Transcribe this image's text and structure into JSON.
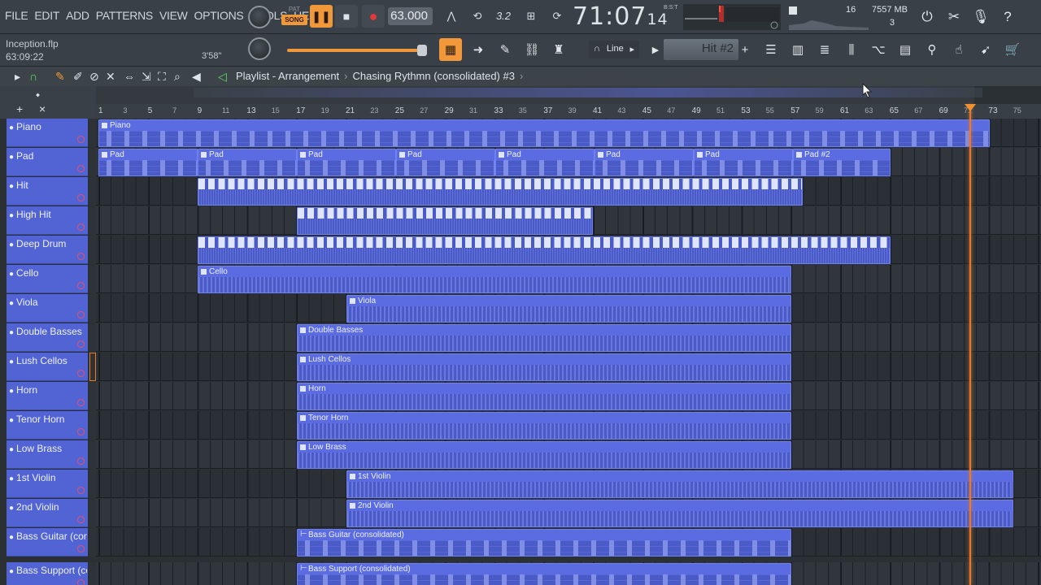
{
  "menu": [
    "FILE",
    "EDIT",
    "ADD",
    "PATTERNS",
    "VIEW",
    "OPTIONS",
    "TOOLS",
    "HELP"
  ],
  "transport": {
    "pat_label": "PAT",
    "song_label": "SONG",
    "play_icon": "pause-icon",
    "stop_icon": "stop-icon",
    "record_icon": "record-icon",
    "tempo": "63.000",
    "time_main": "71:07",
    "time_sub": "14",
    "time_format": "B:S:T"
  },
  "cpu_panel": {
    "voices": "16",
    "memory": "7557 MB",
    "polyphony": "3"
  },
  "project": {
    "name": "Inception.flp",
    "time": "63:09:22",
    "length": "3'58\""
  },
  "snap": {
    "label": "Line"
  },
  "selected_pattern": {
    "label": "Hit #2",
    "add_label": "+"
  },
  "playlist": {
    "title": "Playlist - Arrangement",
    "pattern": "Chasing Rythmn (consolidated) #3"
  },
  "ruler": {
    "major": [
      "1",
      "5",
      "9",
      "13",
      "17",
      "21",
      "25",
      "29",
      "33",
      "37",
      "41",
      "45",
      "49",
      "53",
      "57",
      "61",
      "65",
      "69",
      "73"
    ],
    "minor": [
      "3",
      "7",
      "11",
      "15",
      "19",
      "23",
      "27",
      "31",
      "35",
      "39",
      "43",
      "47",
      "51",
      "55",
      "59",
      "63",
      "67",
      "71",
      "75"
    ]
  },
  "tracks": [
    {
      "name": "Piano"
    },
    {
      "name": "Pad"
    },
    {
      "name": "Hit"
    },
    {
      "name": "High Hit"
    },
    {
      "name": "Deep Drum"
    },
    {
      "name": "Cello"
    },
    {
      "name": "Viola"
    },
    {
      "name": "Double Basses"
    },
    {
      "name": "Lush Cellos"
    },
    {
      "name": "Horn"
    },
    {
      "name": "Tenor Horn"
    },
    {
      "name": "Low Brass"
    },
    {
      "name": "1st Violin"
    },
    {
      "name": "2nd Violin"
    },
    {
      "name": "Bass Guitar (conso..."
    },
    {
      "name": "Bass Support (con..."
    }
  ],
  "clips": {
    "piano": "Piano",
    "pad": "Pad",
    "pad2": "Pad #2",
    "cello": "Cello",
    "viola": "Viola",
    "double_basses": "Double Basses",
    "lush_cellos": "Lush Cellos",
    "horn": "Horn",
    "tenor_horn": "Tenor Horn",
    "low_brass": "Low Brass",
    "violin1": "1st Violin",
    "violin2": "2nd Violin",
    "bass_guitar": "Bass Guitar (consolidated)",
    "bass_support": "Bass Support (consolidated)"
  },
  "colors": {
    "accent": "#f1993a",
    "track": "#5264d4",
    "clip": "#4a5bc8",
    "playhead": "#e8792b"
  }
}
